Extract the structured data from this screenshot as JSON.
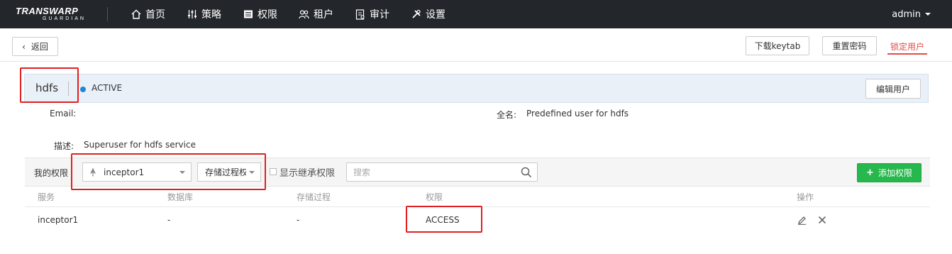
{
  "brand": {
    "line1": "TRANSWARP",
    "line2": "GUARDIAN"
  },
  "nav": [
    {
      "label": "首页",
      "icon": "home-icon"
    },
    {
      "label": "策略",
      "icon": "sliders-icon"
    },
    {
      "label": "权限",
      "icon": "list-icon"
    },
    {
      "label": "租户",
      "icon": "users-icon"
    },
    {
      "label": "审计",
      "icon": "audit-icon"
    },
    {
      "label": "设置",
      "icon": "tools-icon"
    }
  ],
  "user_menu": {
    "label": "admin"
  },
  "toolbar": {
    "back_label": "返回",
    "keytab_label": "下载keytab",
    "reset_label": "重置密码",
    "lock_label": "锁定用户"
  },
  "user": {
    "name": "hdfs",
    "status": "ACTIVE",
    "edit_label": "编辑用户"
  },
  "fields": {
    "email_label": "Email:",
    "email_value": "",
    "fullname_label": "全名:",
    "fullname_value": "Predefined user for hdfs",
    "desc_label": "描述:",
    "desc_value": "Superuser for hdfs service"
  },
  "perm_filter": {
    "label": "我的权限",
    "service_select": "inceptor1",
    "type_select": "存储过程权",
    "inherit_label": "显示继承权限",
    "search_placeholder": "搜索",
    "add_label": "添加权限"
  },
  "table": {
    "headers": [
      "服务",
      "数据库",
      "存储过程",
      "权限",
      "操作"
    ],
    "rows": [
      {
        "service": "inceptor1",
        "database": "-",
        "procedure": "-",
        "permission": "ACCESS"
      }
    ]
  },
  "colors": {
    "topbar": "#23272c",
    "accent_red": "#e44b4b",
    "status_blue": "#1e88d8",
    "add_green": "#26b84c",
    "highlight": "#e02020"
  }
}
